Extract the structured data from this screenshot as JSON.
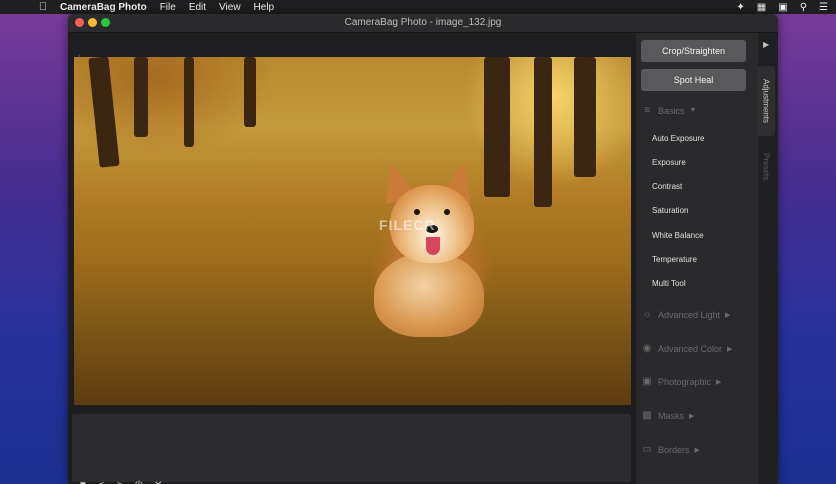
{
  "menubar": {
    "app_name": "CameraBag Photo",
    "menus": [
      "File",
      "Edit",
      "View",
      "Help"
    ]
  },
  "window": {
    "title": "CameraBag Photo - image_132.jpg",
    "watermark": "FILECR"
  },
  "panel": {
    "buttons": [
      "Crop/Straighten",
      "Spot Heal"
    ],
    "sections": [
      {
        "label": "Basics",
        "icon": "sliders-icon",
        "expanded": true,
        "items": [
          "Auto Exposure",
          "Exposure",
          "Contrast",
          "Saturation",
          "White Balance",
          "Temperature",
          "Multi Tool"
        ]
      },
      {
        "label": "Advanced Light",
        "icon": "sun-icon",
        "expanded": false
      },
      {
        "label": "Advanced Color",
        "icon": "palette-icon",
        "expanded": false
      },
      {
        "label": "Photographic",
        "icon": "camera-icon",
        "expanded": false
      },
      {
        "label": "Masks",
        "icon": "mask-icon",
        "expanded": false
      },
      {
        "label": "Borders",
        "icon": "border-icon",
        "expanded": false
      }
    ]
  },
  "sidetabs": [
    "Adjustments",
    "Presets"
  ],
  "colors": {
    "accent": "#59595b",
    "background": "#232325"
  }
}
